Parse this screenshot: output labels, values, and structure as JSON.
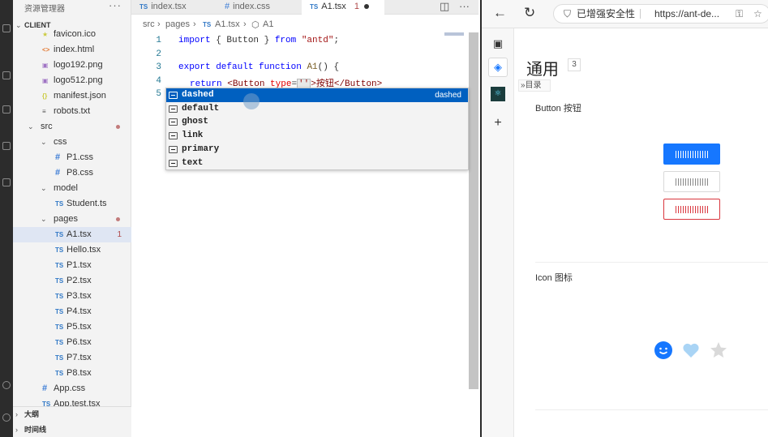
{
  "explorer": {
    "header": "资源管理器",
    "dots": "···",
    "root": "CLIENT",
    "items": [
      {
        "label": "favicon.ico",
        "icon": "star",
        "depth": 2
      },
      {
        "label": "index.html",
        "icon": "<>",
        "depth": 2
      },
      {
        "label": "logo192.png",
        "icon": "img",
        "depth": 2
      },
      {
        "label": "logo512.png",
        "icon": "img",
        "depth": 2
      },
      {
        "label": "manifest.json",
        "icon": "{}",
        "depth": 2
      },
      {
        "label": "robots.txt",
        "icon": "txt",
        "depth": 2
      },
      {
        "label": "src",
        "folder": true,
        "depth": 1,
        "dot": true
      },
      {
        "label": "css",
        "folder": true,
        "depth": 2
      },
      {
        "label": "P1.css",
        "icon": "#",
        "depth": 3
      },
      {
        "label": "P8.css",
        "icon": "#",
        "depth": 3
      },
      {
        "label": "model",
        "folder": true,
        "depth": 2
      },
      {
        "label": "Student.ts",
        "icon": "TS",
        "depth": 3
      },
      {
        "label": "pages",
        "folder": true,
        "depth": 2,
        "dot": true
      },
      {
        "label": "A1.tsx",
        "icon": "TS",
        "depth": 3,
        "selected": true,
        "count": "1"
      },
      {
        "label": "Hello.tsx",
        "icon": "TS",
        "depth": 3
      },
      {
        "label": "P1.tsx",
        "icon": "TS",
        "depth": 3
      },
      {
        "label": "P2.tsx",
        "icon": "TS",
        "depth": 3
      },
      {
        "label": "P3.tsx",
        "icon": "TS",
        "depth": 3
      },
      {
        "label": "P4.tsx",
        "icon": "TS",
        "depth": 3
      },
      {
        "label": "P5.tsx",
        "icon": "TS",
        "depth": 3
      },
      {
        "label": "P6.tsx",
        "icon": "TS",
        "depth": 3
      },
      {
        "label": "P7.tsx",
        "icon": "TS",
        "depth": 3
      },
      {
        "label": "P8.tsx",
        "icon": "TS",
        "depth": 3
      },
      {
        "label": "App.css",
        "icon": "#",
        "depth": 2
      },
      {
        "label": "App.test.tsx",
        "icon": "TS",
        "depth": 2
      }
    ],
    "outline": "大纲",
    "timeline": "时间线"
  },
  "tabs": [
    {
      "prefix": "TS",
      "label": "index.tsx"
    },
    {
      "prefix": "#",
      "label": "index.css"
    },
    {
      "prefix": "TS",
      "label": "A1.tsx",
      "count": "1",
      "active": true
    }
  ],
  "breadcrumb": [
    "src",
    "pages",
    "A1.tsx",
    "A1"
  ],
  "editor": {
    "line_numbers": [
      "1",
      "2",
      "3",
      "4",
      "5"
    ],
    "line1": {
      "kw1": "import",
      "p1": " { Button } ",
      "kw2": "from",
      "str": " \"antd\"",
      "end": ";"
    },
    "line3": {
      "kw1": "export",
      "kw2": " default",
      "kw3": " function",
      "fn": " A1",
      "rest": "() {"
    },
    "line4": {
      "ret": "return ",
      "open": "<Button ",
      "attr": "type",
      "eq": "=",
      "q": "''",
      "close": ">按钮</Button>"
    }
  },
  "suggestions": [
    {
      "label": "dashed",
      "detail": "dashed",
      "highlighted": true
    },
    {
      "label": "default"
    },
    {
      "label": "ghost"
    },
    {
      "label": "link"
    },
    {
      "label": "primary"
    },
    {
      "label": "text"
    }
  ],
  "browser": {
    "security": "已增强安全性",
    "url": "https://ant-de...",
    "page_title": "通用",
    "page_count": "3",
    "toc": "目录",
    "section_button": "Button 按钮",
    "section_icon": "Icon 图标",
    "colors": {
      "primary": "#1677ff",
      "danger": "#d9363e"
    }
  }
}
